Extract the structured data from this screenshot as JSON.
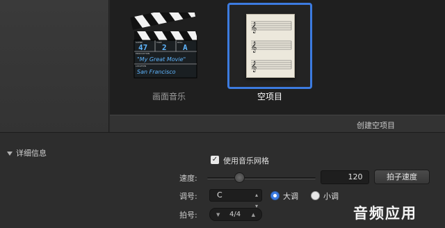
{
  "templates": [
    {
      "label": "画面音乐",
      "selected": false,
      "icon": "clapperboard-icon",
      "clapper_text": {
        "roll": "47",
        "take": "2",
        "scene": "A",
        "title": "\"My Great Movie\"",
        "location": "San Francisco",
        "small_labels": [
          "SCENE",
          "TAKE",
          "ROLL",
          "PRODUCTION",
          "LOCATION"
        ]
      }
    },
    {
      "label": "空项目",
      "selected": true,
      "icon": "sheet-music-icon"
    }
  ],
  "footer": {
    "create_button": "创建空项目"
  },
  "details": {
    "header": "详细信息",
    "use_grid": {
      "label": "使用音乐网格",
      "checked": true
    },
    "tempo": {
      "label": "速度:",
      "value": "120",
      "tap_button": "拍子速度",
      "slider_fraction": 0.3
    },
    "key": {
      "label": "调号:",
      "value": "C",
      "major_label": "大调",
      "minor_label": "小调",
      "mode": "major"
    },
    "time_signature": {
      "label": "拍号:",
      "value": "4/4"
    }
  },
  "watermark": "音频应用",
  "colors": {
    "accent": "#3c7be0",
    "background": "#2b2b2b"
  }
}
